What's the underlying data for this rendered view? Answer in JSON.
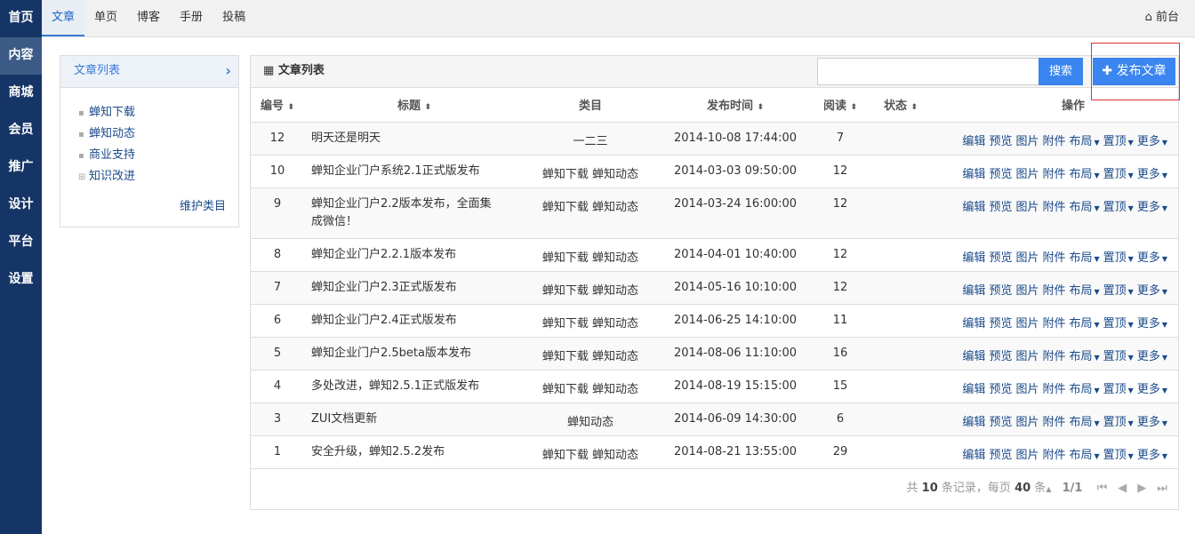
{
  "sidebar": {
    "items": [
      {
        "label": "首页"
      },
      {
        "label": "内容",
        "active": true
      },
      {
        "label": "商城"
      },
      {
        "label": "会员"
      },
      {
        "label": "推广"
      },
      {
        "label": "设计"
      },
      {
        "label": "平台"
      },
      {
        "label": "设置"
      }
    ]
  },
  "topnav": {
    "tabs": [
      "文章",
      "单页",
      "博客",
      "手册",
      "投稿"
    ],
    "front": "前台"
  },
  "left_panel": {
    "title": "文章列表",
    "items": [
      "蝉知下载",
      "蝉知动态",
      "商业支持",
      "知识改进"
    ],
    "maintain": "维护类目"
  },
  "main": {
    "title": "文章列表",
    "search_placeholder": "",
    "search_label": "搜索",
    "publish_label": "发布文章",
    "columns": [
      "编号",
      "标题",
      "类目",
      "发布时间",
      "阅读",
      "状态",
      "操作"
    ],
    "actions": [
      "编辑",
      "预览",
      "图片",
      "附件",
      "布局",
      "置顶",
      "更多"
    ],
    "rows": [
      {
        "id": "12",
        "title": "明天还是明天",
        "category": "一二三",
        "time": "2014-10-08 17:44:00",
        "views": "7"
      },
      {
        "id": "10",
        "title": "蝉知企业门户系统2.1正式版发布",
        "category": "蝉知下载 蝉知动态",
        "time": "2014-03-03 09:50:00",
        "views": "12"
      },
      {
        "id": "9",
        "title": "蝉知企业门户2.2版本发布，全面集成微信！",
        "category": "蝉知下载 蝉知动态",
        "time": "2014-03-24 16:00:00",
        "views": "12"
      },
      {
        "id": "8",
        "title": "蝉知企业门户2.2.1版本发布",
        "category": "蝉知下载 蝉知动态",
        "time": "2014-04-01 10:40:00",
        "views": "12"
      },
      {
        "id": "7",
        "title": "蝉知企业门户2.3正式版发布",
        "category": "蝉知下载 蝉知动态",
        "time": "2014-05-16 10:10:00",
        "views": "12"
      },
      {
        "id": "6",
        "title": "蝉知企业门户2.4正式版发布",
        "category": "蝉知下载 蝉知动态",
        "time": "2014-06-25 14:10:00",
        "views": "11"
      },
      {
        "id": "5",
        "title": "蝉知企业门户2.5beta版本发布",
        "category": "蝉知下载 蝉知动态",
        "time": "2014-08-06 11:10:00",
        "views": "16"
      },
      {
        "id": "4",
        "title": "多处改进，蝉知2.5.1正式版发布",
        "category": "蝉知下载 蝉知动态",
        "time": "2014-08-19 15:15:00",
        "views": "15"
      },
      {
        "id": "3",
        "title": "ZUI文档更新",
        "category": "蝉知动态",
        "time": "2014-06-09 14:30:00",
        "views": "6"
      },
      {
        "id": "1",
        "title": "安全升级，蝉知2.5.2发布",
        "category": "蝉知下载 蝉知动态",
        "time": "2014-08-21 13:55:00",
        "views": "29"
      }
    ],
    "footer": {
      "total_prefix": "共",
      "total": "10",
      "total_suffix": "条记录，每页",
      "per_page": "40",
      "per_suffix": "条",
      "page": "1/1"
    }
  }
}
